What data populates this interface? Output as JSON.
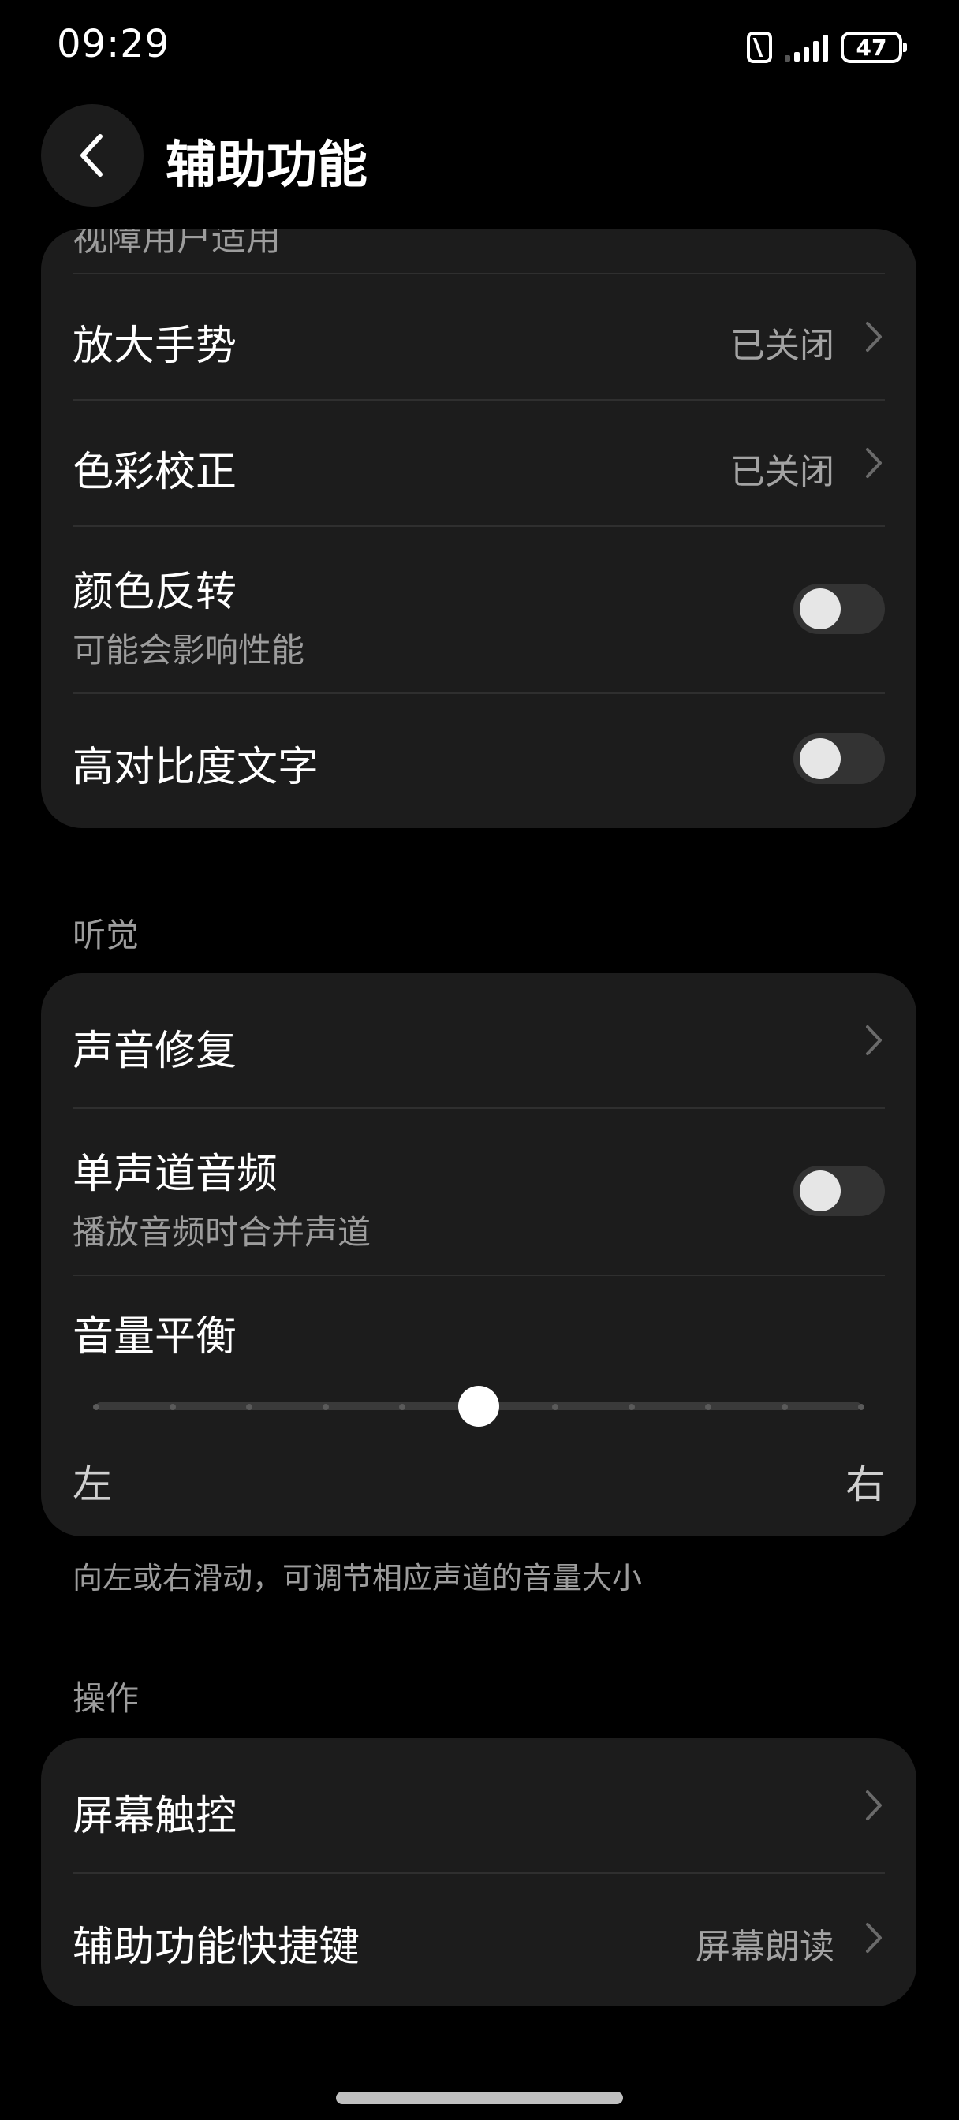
{
  "status_bar": {
    "time": "09:29",
    "battery": "47"
  },
  "header": {
    "title": "辅助功能"
  },
  "vision_card": {
    "partial_label": "视障用户适用",
    "items": [
      {
        "label": "放大手势",
        "value": "已关闭"
      },
      {
        "label": "色彩校正",
        "value": "已关闭"
      },
      {
        "label": "颜色反转",
        "sublabel": "可能会影响性能",
        "toggle": false
      },
      {
        "label": "高对比度文字",
        "toggle": false
      }
    ]
  },
  "hearing": {
    "section_label": "听觉",
    "items": [
      {
        "label": "声音修复"
      },
      {
        "label": "单声道音频",
        "sublabel": "播放音频时合并声道",
        "toggle": false
      }
    ],
    "balance": {
      "label": "音量平衡",
      "left_label": "左",
      "right_label": "右",
      "value_fraction": 0.5,
      "hint": "向左或右滑动，可调节相应声道的音量大小"
    }
  },
  "operation": {
    "section_label": "操作",
    "items": [
      {
        "label": "屏幕触控"
      },
      {
        "label": "辅助功能快捷键",
        "value": "屏幕朗读"
      }
    ]
  },
  "colors": {
    "background": "#000000",
    "card": "#1c1c1c",
    "secondary_text": "#9c9c9c"
  }
}
